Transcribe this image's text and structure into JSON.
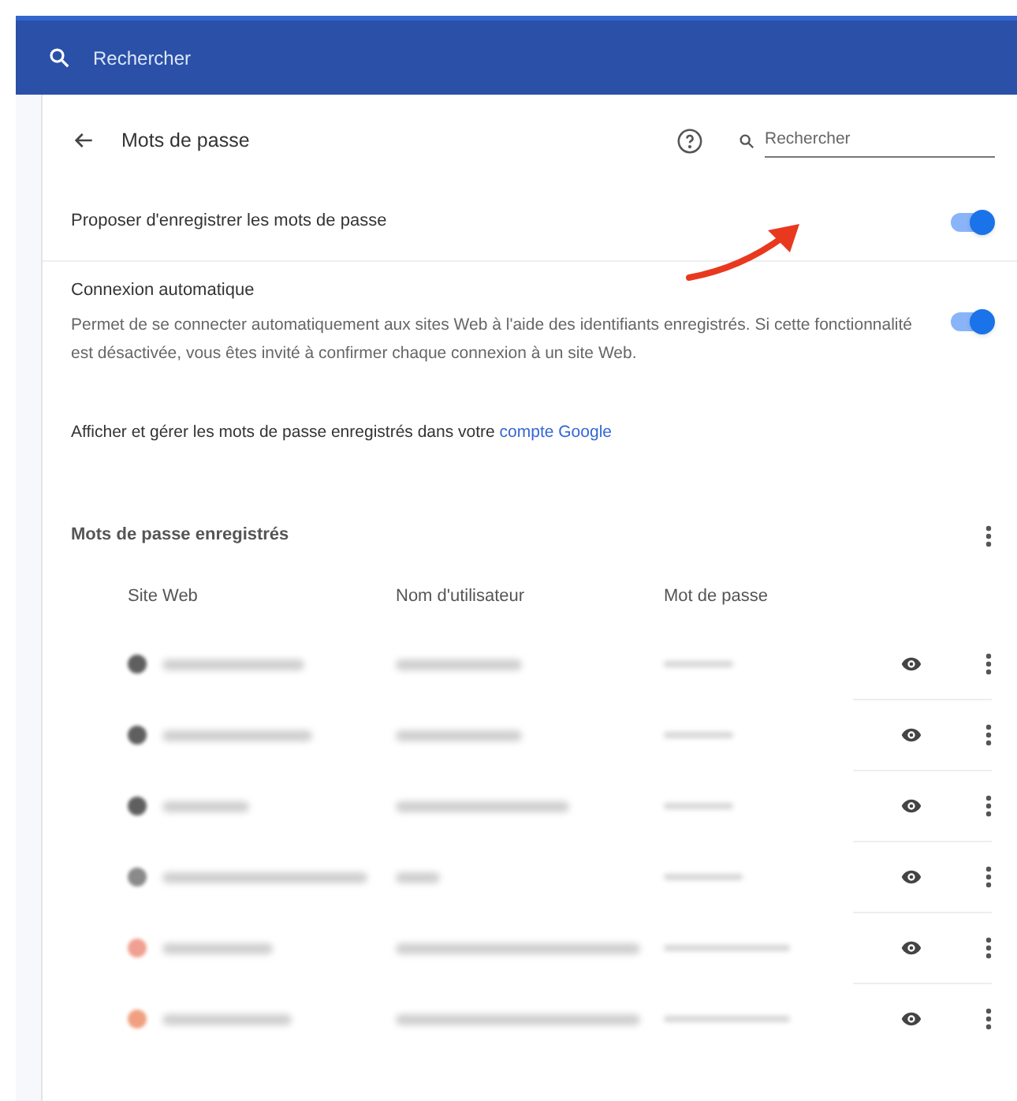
{
  "top_search": {
    "placeholder": "Rechercher"
  },
  "header": {
    "title": "Mots de passe",
    "search": {
      "placeholder": "Rechercher"
    }
  },
  "settings": [
    {
      "title": "Proposer d'enregistrer les mots de passe",
      "on": true
    },
    {
      "title": "Connexion automatique",
      "description": "Permet de se connecter automatiquement aux sites Web à l'aide des identifiants enregistrés. Si cette fonctionnalité est désactivée, vous êtes invité à confirmer chaque connexion à un site Web.",
      "on": true
    }
  ],
  "account_note": {
    "text": "Afficher et gérer les mots de passe enregistrés dans votre ",
    "link": "compte Google"
  },
  "saved": {
    "title": "Mots de passe enregistrés",
    "columns": [
      "Site Web",
      "Nom d'utilisateur",
      "Mot de passe"
    ],
    "rows": [
      {
        "color": "#5f5f5f"
      },
      {
        "color": "#5f5f5f"
      },
      {
        "color": "#5f5f5f"
      },
      {
        "color": "#8a8a8a"
      },
      {
        "color": "#f0a090"
      },
      {
        "color": "#f0a080"
      }
    ]
  }
}
